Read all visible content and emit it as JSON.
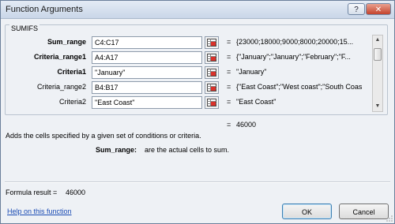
{
  "window": {
    "title": "Function Arguments",
    "help_glyph": "?",
    "close_glyph": "✕"
  },
  "function_name": "SUMIFS",
  "arguments": [
    {
      "label": "Sum_range",
      "bold": true,
      "value": "C4:C17",
      "result": "{23000;18000;9000;8000;20000;15..."
    },
    {
      "label": "Criteria_range1",
      "bold": true,
      "value": "A4:A17",
      "result": "{\"January\";\"January\";\"February\";\"F..."
    },
    {
      "label": "Criteria1",
      "bold": true,
      "value": "\"January\"",
      "result": "\"January\""
    },
    {
      "label": "Criteria_range2",
      "bold": false,
      "value": "B4:B17",
      "result": "{\"East Coast\";\"West coast\";\"South Coas"
    },
    {
      "label": "Criteria2",
      "bold": false,
      "value": "\"East Coast\"",
      "result": "\"East Coast\""
    }
  ],
  "eq_sign": "=",
  "function_result": "46000",
  "description": "Adds the cells specified by a given set of conditions or criteria.",
  "arg_help": {
    "name": "Sum_range:",
    "text": "are the actual cells to sum."
  },
  "formula_result": {
    "label": "Formula result =",
    "value": "46000"
  },
  "help_link": "Help on this function",
  "buttons": {
    "ok": "OK",
    "cancel": "Cancel"
  },
  "icons": {
    "collapse": "range-collapse-icon"
  }
}
